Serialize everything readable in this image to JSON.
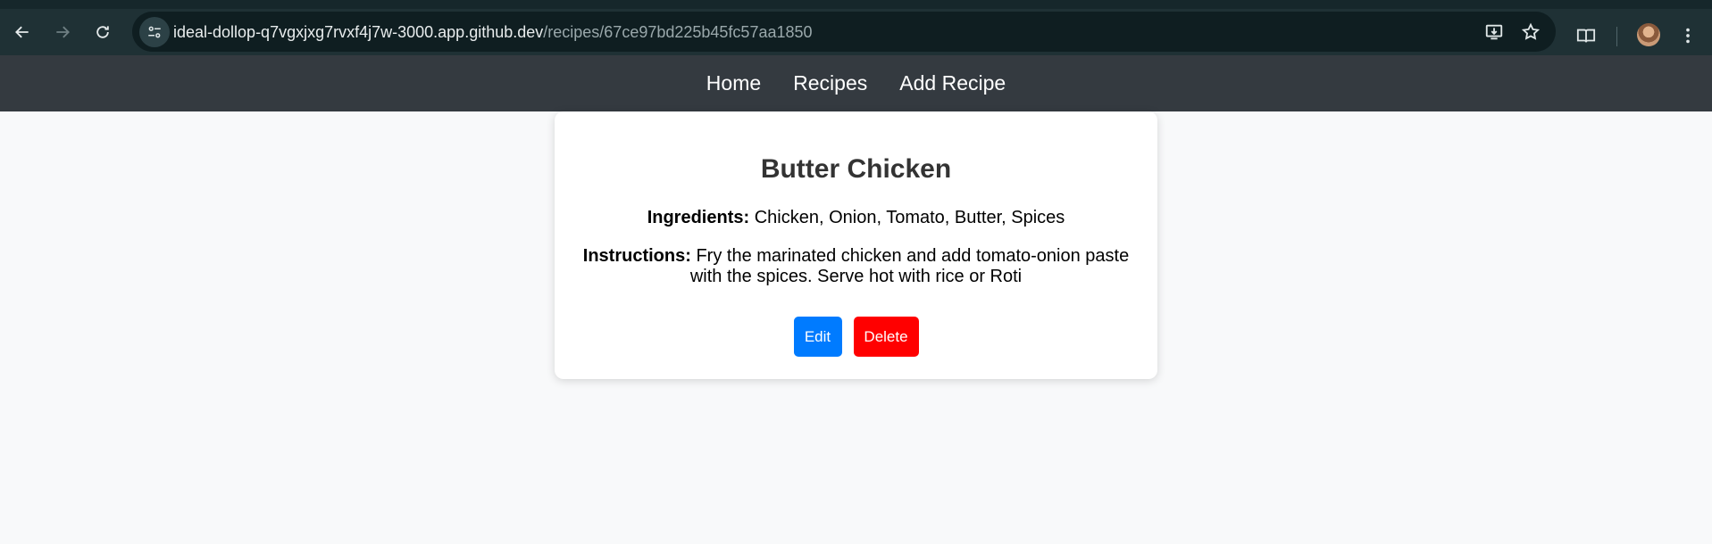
{
  "browser": {
    "url_host": "ideal-dollop-q7vgxjxg7rvxf4j7w-3000.app.github.dev",
    "url_path": "/recipes/67ce97bd225b45fc57aa1850",
    "icons": [
      "back-arrow-icon",
      "forward-arrow-icon",
      "reload-icon",
      "site-info-icon",
      "install-app-icon",
      "bookmark-star-icon",
      "reading-mode-icon",
      "profile-avatar",
      "more-menu-icon"
    ]
  },
  "nav": {
    "home": "Home",
    "recipes": "Recipes",
    "add_recipe": "Add Recipe"
  },
  "recipe": {
    "title": "Butter Chicken",
    "ingredients_label": "Ingredients:",
    "ingredients": "Chicken, Onion, Tomato, Butter, Spices",
    "instructions_label": "Instructions:",
    "instructions": "Fry the marinated chicken and add tomato-onion paste with the spices. Serve hot with rice or Roti"
  },
  "actions": {
    "edit": "Edit",
    "delete": "Delete"
  },
  "colors": {
    "nav_bg": "#343a40",
    "page_bg": "#f8f9fa",
    "edit_button": "#007bff",
    "delete_button": "#ff0000"
  }
}
